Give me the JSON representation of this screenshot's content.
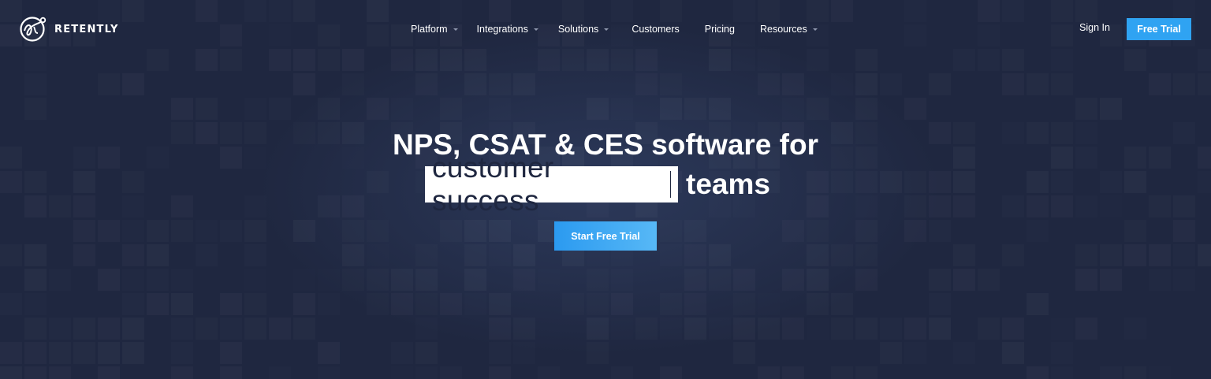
{
  "header": {
    "logo_text": "RETENTLY",
    "nav": [
      {
        "label": "Platform",
        "has_dropdown": true
      },
      {
        "label": "Integrations",
        "has_dropdown": true
      },
      {
        "label": "Solutions",
        "has_dropdown": true
      },
      {
        "label": "Customers",
        "has_dropdown": false
      },
      {
        "label": "Pricing",
        "has_dropdown": false
      },
      {
        "label": "Resources",
        "has_dropdown": true
      }
    ],
    "sign_in_label": "Sign In",
    "free_trial_label": "Free Trial"
  },
  "hero": {
    "title_line1": "NPS, CSAT & CES software for",
    "highlight_text": "customer success",
    "title_line2_suffix": "teams",
    "cta_label": "Start Free Trial"
  },
  "colors": {
    "background": "#1f2740",
    "accent": "#2fa3f2",
    "text": "#ffffff",
    "icon": "chevron-down-icon"
  }
}
